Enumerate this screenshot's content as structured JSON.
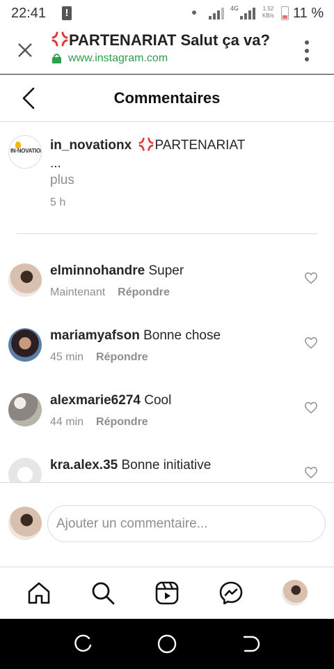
{
  "status_bar": {
    "time": "22:41",
    "network": "4G",
    "speed_value": "1.52",
    "speed_unit": "KB/s",
    "battery": "11 %"
  },
  "browser": {
    "page_title_icon": "anger-symbol-emoji",
    "page_title": "PARTENARIAT Salut ça va?",
    "url": "www.instagram.com",
    "secure_color": "#2e9e4f"
  },
  "header": {
    "title": "Commentaires"
  },
  "caption": {
    "logo_text": "IN·NOVATION",
    "username": "in_novationx",
    "text": "PARTENARIAT",
    "ellipsis": "...",
    "more": "plus",
    "time": "5 h"
  },
  "comments": [
    {
      "username": "elminnohandre",
      "text": "Super",
      "time": "Maintenant",
      "reply": "Répondre"
    },
    {
      "username": "mariamyafson",
      "text": "Bonne chose",
      "time": "45 min",
      "reply": "Répondre"
    },
    {
      "username": "alexmarie6274",
      "text": "Cool",
      "time": "44 min",
      "reply": "Répondre"
    },
    {
      "username": "kra.alex.35",
      "text": "Bonne initiative",
      "time": "",
      "reply": ""
    }
  ],
  "add_comment": {
    "placeholder": "Ajouter un commentaire..."
  },
  "colors": {
    "accent_emoji": "#e53935",
    "muted_text": "#8e8e8e",
    "border": "#dbdbdb"
  }
}
